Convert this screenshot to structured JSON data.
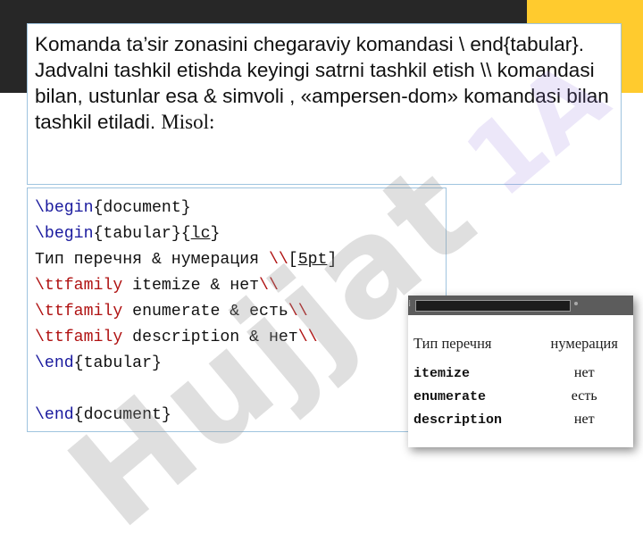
{
  "description": {
    "text": "Komanda ta’sir zonasini chegaraviy komandasi \\ end{tabular}. Jadvalni tashkil etishda keyingi satrni tashkil etish \\\\ komandasi bilan, ustunlar esa & simvoli , «ampersen-dom» komandasi bilan tashkil etiladi. ",
    "misol": "Misol:"
  },
  "code": {
    "lines": [
      [
        {
          "t": "\\begin",
          "c": "kw"
        },
        {
          "t": "{document}",
          "c": ""
        }
      ],
      [
        {
          "t": "\\begin",
          "c": "kw"
        },
        {
          "t": "{tabular}{",
          "c": ""
        },
        {
          "t": "lc",
          "c": "ul"
        },
        {
          "t": "}",
          "c": ""
        }
      ],
      [
        {
          "t": "Тип перечня & нумерация ",
          "c": ""
        },
        {
          "t": "\\\\",
          "c": "red"
        },
        {
          "t": "[",
          "c": ""
        },
        {
          "t": "5pt",
          "c": "ul"
        },
        {
          "t": "]",
          "c": ""
        }
      ],
      [
        {
          "t": "\\ttfamily",
          "c": "red"
        },
        {
          "t": " itemize & нет",
          "c": ""
        },
        {
          "t": "\\\\",
          "c": "red"
        }
      ],
      [
        {
          "t": "\\ttfamily",
          "c": "red"
        },
        {
          "t": " enumerate & есть",
          "c": ""
        },
        {
          "t": "\\\\",
          "c": "red"
        }
      ],
      [
        {
          "t": "\\ttfamily",
          "c": "red"
        },
        {
          "t": " description & нет",
          "c": ""
        },
        {
          "t": "\\\\",
          "c": "red"
        }
      ],
      [
        {
          "t": "\\end",
          "c": "kw"
        },
        {
          "t": "{tabular}",
          "c": ""
        }
      ],
      [],
      [
        {
          "t": "\\end",
          "c": "kw"
        },
        {
          "t": "{document}",
          "c": ""
        }
      ]
    ]
  },
  "preview": {
    "headers": [
      "Тип перечня",
      "нумерация"
    ],
    "rows": [
      [
        "itemize",
        "нет"
      ],
      [
        "enumerate",
        "есть"
      ],
      [
        "description",
        "нет"
      ]
    ]
  },
  "watermark": "Hujjat",
  "watermark2": "1A",
  "colors": {
    "dark_band": "#272727",
    "yellow_band": "#ffcb2e",
    "keyword": "#1a1a9e",
    "escape": "#b01313",
    "box_border": "#9fc4df"
  }
}
